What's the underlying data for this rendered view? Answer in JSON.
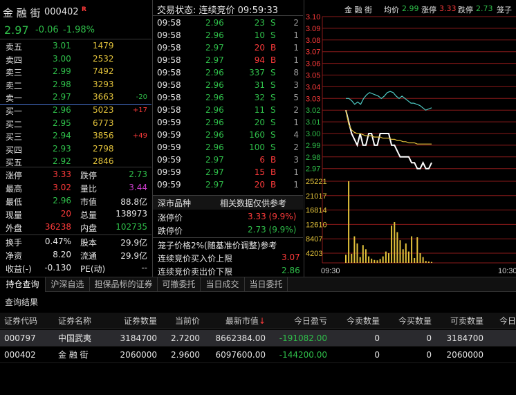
{
  "quote": {
    "name": "金 融 街",
    "code": "000402",
    "badge": "R",
    "price": "2.97",
    "change": "-0.06",
    "change_pct": "-1.98%"
  },
  "order_book": {
    "sell": [
      {
        "label": "卖五",
        "price": "3.01",
        "vol": "1479",
        "delta": ""
      },
      {
        "label": "卖四",
        "price": "3.00",
        "vol": "2532",
        "delta": ""
      },
      {
        "label": "卖三",
        "price": "2.99",
        "vol": "7492",
        "delta": ""
      },
      {
        "label": "卖二",
        "price": "2.98",
        "vol": "3293",
        "delta": ""
      },
      {
        "label": "卖一",
        "price": "2.97",
        "vol": "3663",
        "delta": "-20"
      }
    ],
    "buy": [
      {
        "label": "买一",
        "price": "2.96",
        "vol": "5023",
        "delta": "+17"
      },
      {
        "label": "买二",
        "price": "2.95",
        "vol": "6773",
        "delta": ""
      },
      {
        "label": "买三",
        "price": "2.94",
        "vol": "3856",
        "delta": "+49"
      },
      {
        "label": "买四",
        "price": "2.93",
        "vol": "2798",
        "delta": ""
      },
      {
        "label": "买五",
        "price": "2.92",
        "vol": "2846",
        "delta": ""
      }
    ]
  },
  "stats": [
    {
      "l1": "涨停",
      "v1": "3.33",
      "l2": "跌停",
      "v2": "2.73"
    },
    {
      "l1": "最高",
      "v1": "3.02",
      "l2": "量比",
      "v2": "3.44"
    },
    {
      "l1": "最低",
      "v1": "2.96",
      "l2": "市值",
      "v2": "88.8亿"
    },
    {
      "l1": "现量",
      "v1": "20",
      "l2": "总量",
      "v2": "138973"
    },
    {
      "l1": "外盘",
      "v1": "36238",
      "l2": "内盘",
      "v2": "102735"
    }
  ],
  "stats2": [
    {
      "l1": "换手",
      "v1": "0.47%",
      "l2": "股本",
      "v2": "29.9亿"
    },
    {
      "l1": "净资",
      "v1": "8.20",
      "l2": "流通",
      "v2": "29.9亿"
    },
    {
      "l1": "收益(-)",
      "v1": "-0.130",
      "l2": "PE(动)",
      "v2": "--"
    }
  ],
  "ticks": {
    "header": "交易状态: 连续竞价 09:59:33",
    "rows": [
      {
        "t": "09:58",
        "p": "2.96",
        "v": "23",
        "s": "S",
        "n": "2"
      },
      {
        "t": "09:58",
        "p": "2.96",
        "v": "10",
        "s": "S",
        "n": "1"
      },
      {
        "t": "09:58",
        "p": "2.97",
        "v": "20",
        "s": "B",
        "n": "1"
      },
      {
        "t": "09:58",
        "p": "2.97",
        "v": "94",
        "s": "B",
        "n": "1"
      },
      {
        "t": "09:58",
        "p": "2.96",
        "v": "337",
        "s": "S",
        "n": "8"
      },
      {
        "t": "09:58",
        "p": "2.96",
        "v": "31",
        "s": "S",
        "n": "3"
      },
      {
        "t": "09:58",
        "p": "2.96",
        "v": "32",
        "s": "S",
        "n": "5"
      },
      {
        "t": "09:58",
        "p": "2.96",
        "v": "11",
        "s": "S",
        "n": "2"
      },
      {
        "t": "09:59",
        "p": "2.96",
        "v": "20",
        "s": "S",
        "n": "1"
      },
      {
        "t": "09:59",
        "p": "2.96",
        "v": "160",
        "s": "S",
        "n": "4"
      },
      {
        "t": "09:59",
        "p": "2.96",
        "v": "100",
        "s": "S",
        "n": "2"
      },
      {
        "t": "09:59",
        "p": "2.97",
        "v": "6",
        "s": "B",
        "n": "3"
      },
      {
        "t": "09:59",
        "p": "2.97",
        "v": "15",
        "s": "B",
        "n": "1"
      },
      {
        "t": "09:59",
        "p": "2.97",
        "v": "20",
        "s": "B",
        "n": "1"
      }
    ]
  },
  "info": {
    "title": "深市品种",
    "subtitle": "相关数据仅供参考",
    "limit_up_label": "涨停价",
    "limit_up_val": "3.33 (9.9%)",
    "limit_dn_label": "跌停价",
    "limit_dn_val": "2.73 (9.9%)",
    "cage_title": "笼子价格2%(随基准价调整)参考",
    "buy_cap_label": "连续竞价买入价上限",
    "buy_cap_val": "3.07",
    "sell_cap_label": "连续竞价卖出价下限",
    "sell_cap_val": "2.86"
  },
  "chart_header": {
    "name": "金 融 街",
    "avg_label": "均价",
    "avg_val": "2.99",
    "up_label": "涨停",
    "up_val": "3.33",
    "dn_label": "跌停",
    "dn_val": "2.73",
    "cage_label": "笼子"
  },
  "chart_data": {
    "type": "line",
    "title": "",
    "price_ticks": [
      "3.10",
      "3.09",
      "3.08",
      "3.07",
      "3.06",
      "3.05",
      "3.04",
      "3.03",
      "3.02",
      "3.01",
      "3.00",
      "2.99",
      "2.98",
      "2.97"
    ],
    "volume_ticks": [
      "25221",
      "21017",
      "16814",
      "12610",
      "8407",
      "4203"
    ],
    "x_ticks": [
      "09:30",
      "10:30"
    ],
    "ylim": [
      2.965,
      3.105
    ],
    "series": [
      {
        "color": "#4ecac4",
        "values": [
          3.03,
          3.03,
          3.028,
          3.025,
          3.027,
          3.025,
          3.03,
          3.033,
          3.035,
          3.034,
          3.033,
          3.032,
          3.03,
          3.032,
          3.035,
          3.036,
          3.035,
          3.032,
          3.03,
          3.032,
          3.03,
          3.028,
          3.026,
          3.026,
          3.025,
          3.024,
          3.022,
          3.02,
          3.021,
          3.022
        ]
      },
      {
        "color": "#ffffff",
        "values": [
          3.02,
          3.01,
          3.0,
          2.995,
          2.99,
          3.0,
          2.99,
          2.99,
          3.0,
          3.0,
          2.99,
          2.99,
          3.0,
          3.0,
          3.0,
          3.0,
          2.99,
          2.99,
          2.985,
          2.98,
          2.98,
          2.98,
          2.98,
          2.975,
          2.975,
          2.97,
          2.97,
          2.975,
          2.97,
          2.97,
          2.975
        ]
      },
      {
        "color": "#e2c23b",
        "values": [
          3.02,
          3.008,
          3.003,
          3.001,
          3.0,
          3.0,
          2.999,
          2.998,
          2.998,
          2.998,
          2.997,
          2.997,
          2.997,
          2.996,
          2.996,
          2.996,
          2.995,
          2.995,
          2.994,
          2.994,
          2.993,
          2.993,
          2.992,
          2.992,
          2.992,
          2.991,
          2.991,
          2.991,
          2.991,
          2.991,
          2.991
        ]
      }
    ],
    "volume": [
      2500,
      25221,
      2800,
      8200,
      6000,
      1800,
      5500,
      4200,
      2000,
      1300,
      900,
      800,
      1200,
      2000,
      3500,
      3000,
      11500,
      12600,
      9500,
      7000,
      4200,
      6000,
      3500,
      8200,
      1500,
      7900,
      3000,
      1800,
      600,
      400,
      300
    ]
  },
  "tabs": [
    "持仓查询",
    "沪深自选",
    "担保品标的证券",
    "可撤委托",
    "当日成交",
    "当日委托"
  ],
  "query_result": "查询结果",
  "table": {
    "columns": [
      "证券代码",
      "证券名称",
      "证券数量",
      "当前价",
      "最新市值↓",
      "今日盈亏",
      "今卖数量",
      "今买数量",
      "可卖数量",
      "今日"
    ],
    "rows": [
      [
        "000797",
        "中国武夷",
        "3184700",
        "2.7200",
        "8662384.00",
        "-191082.00",
        "0",
        "0",
        "3184700",
        ""
      ],
      [
        "000402",
        "金 融 街",
        "2060000",
        "2.9600",
        "6097600.00",
        "-144200.00",
        "0",
        "0",
        "2060000",
        ""
      ]
    ]
  },
  "colors": {
    "up": "#ff3b3b",
    "down": "#2fbf4a",
    "volume": "#e2c23b",
    "grid": "#8b1a1a"
  }
}
